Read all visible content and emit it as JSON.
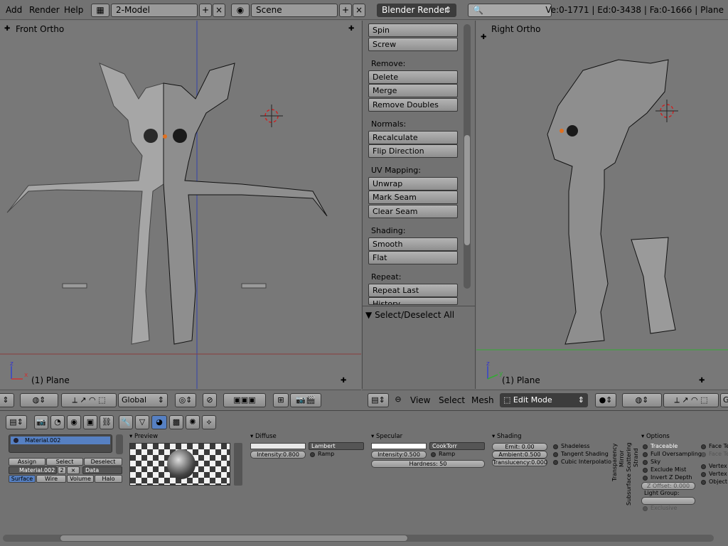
{
  "topbar": {
    "menus": [
      "Add",
      "Render",
      "Help"
    ],
    "screen_layout": "2-Model",
    "scene": "Scene",
    "render_engine": "Blender Render",
    "search_placeholder": "",
    "stats": "Ve:0-1771 | Ed:0-3438 | Fa:0-1666 | Plane"
  },
  "viewports": {
    "left": {
      "label": "Front Ortho",
      "object": "(1) Plane",
      "axis_v": "z",
      "axis_h": "x"
    },
    "right": {
      "label": "Right Ortho",
      "object": "(1) Plane",
      "axis_v": "z",
      "axis_h": "y"
    }
  },
  "toolpanel": {
    "buttons_top": [
      "Spin",
      "Screw"
    ],
    "sections": [
      {
        "title": "Remove:",
        "buttons": [
          "Delete",
          "Merge",
          "Remove Doubles"
        ]
      },
      {
        "title": "Normals:",
        "buttons": [
          "Recalculate",
          "Flip Direction"
        ]
      },
      {
        "title": "UV Mapping:",
        "buttons": [
          "Unwrap",
          "Mark Seam",
          "Clear Seam"
        ]
      },
      {
        "title": "Shading:",
        "buttons": [
          "Smooth",
          "Flat"
        ]
      },
      {
        "title": "Repeat:",
        "buttons": [
          "Repeat Last",
          "History..."
        ]
      }
    ],
    "operator_panel": "Select/Deselect All"
  },
  "header3d_left": {
    "orientation": "Global"
  },
  "header3d_right": {
    "menus": [
      "View",
      "Select",
      "Mesh"
    ],
    "mode": "Edit Mode",
    "orientation_partial": "G"
  },
  "properties": {
    "material_slot": "Material.002",
    "slot_buttons": [
      "Assign",
      "Select",
      "Deselect"
    ],
    "material_name": "Material.002",
    "users": "2",
    "link": "Data",
    "tabs": [
      "Surface",
      "Wire",
      "Volume",
      "Halo"
    ],
    "active_tab": "Surface",
    "preview": {
      "title": "Preview"
    },
    "diffuse": {
      "title": "Diffuse",
      "shader": "Lambert",
      "intensity": "Intensity:0.800",
      "ramp": "Ramp"
    },
    "specular": {
      "title": "Specular",
      "shader": "CookTorr",
      "intensity": "Intensity:0.500",
      "ramp": "Ramp",
      "hardness": "Hardness: 50"
    },
    "shading": {
      "title": "Shading",
      "emit": "Emit: 0.00",
      "ambient": "Ambient:0.500",
      "translucency": "Translucency:0.000",
      "options": [
        "Shadeless",
        "Tangent Shading",
        "Cubic Interpolatio"
      ]
    },
    "collapsed": [
      "Transparency",
      "Mirror",
      "Subsurface Scattering",
      "Strand"
    ],
    "options": {
      "title": "Options",
      "items": [
        "Traceable",
        "Full Oversampling",
        "Sky",
        "Exclude Mist",
        "Invert Z Depth"
      ],
      "z_offset": "Z Offset: 0.000",
      "light_group": "Light Group:",
      "exclusive": "Exclusive",
      "right_items": [
        "Face Te",
        "Face Te",
        "Vertex C",
        "Vertex C",
        "Object C"
      ]
    }
  },
  "colors": {
    "bg": "#727272",
    "viewport": "#787878",
    "selected": "#5680c2",
    "crosshair": "#cc2222"
  }
}
